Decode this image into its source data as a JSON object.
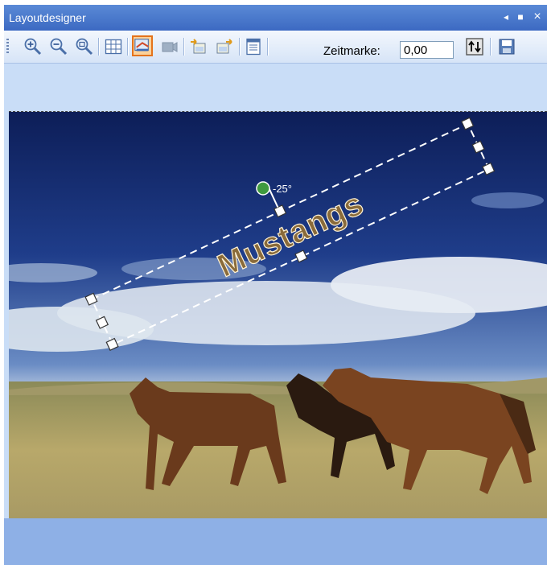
{
  "window": {
    "title": "Layoutdesigner",
    "controls": {
      "pin": "◂",
      "autohide": "■",
      "close": "×"
    }
  },
  "toolbar": {
    "buttons": [
      {
        "name": "zoom-in-icon"
      },
      {
        "name": "zoom-out-icon"
      },
      {
        "name": "zoom-fit-icon"
      },
      {
        "name": "grid-icon"
      },
      {
        "name": "text-tool-icon",
        "active": true
      },
      {
        "name": "camera-icon"
      },
      {
        "name": "import-layout-icon"
      },
      {
        "name": "export-layout-icon"
      },
      {
        "name": "properties-icon"
      }
    ],
    "timestamp_label": "Zeitmarke:",
    "timestamp_value": "0,00",
    "colors": {
      "active_border": "#e4731c",
      "active_fill": "#fbd19a"
    }
  },
  "canvas": {
    "text_object": "Mustangs",
    "rotation_label": "-25°",
    "colors": {
      "text_fill": "#8a6b3a",
      "text_stroke": "#fff3d6",
      "rotation_handle": "#3f9a3f"
    }
  }
}
